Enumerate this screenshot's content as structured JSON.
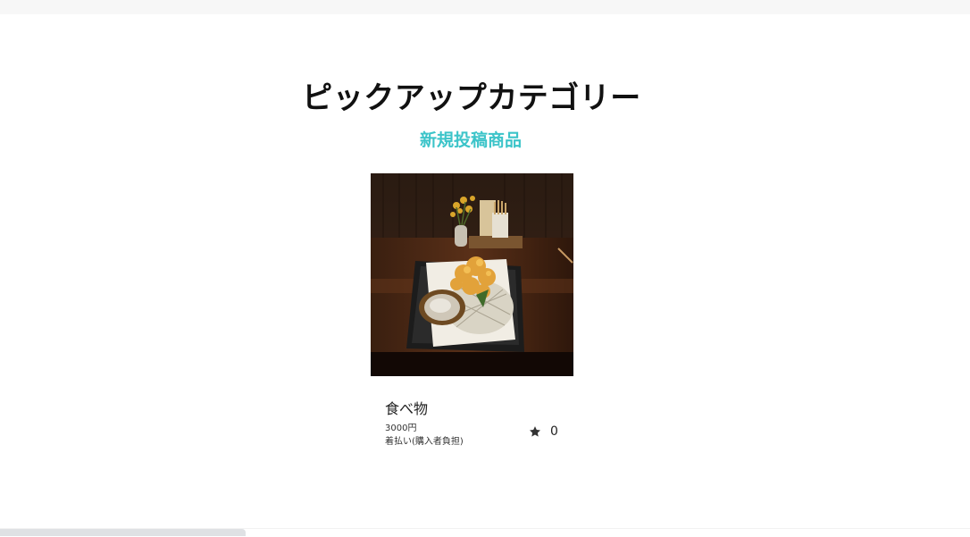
{
  "section": {
    "heading": "ピックアップカテゴリー",
    "subheading": "新規投稿商品"
  },
  "items": [
    {
      "title": "食べ物",
      "price": "3000円",
      "shipping": "着払い(購入者負担)",
      "likes": "0",
      "image": "tempura-dish-photo"
    }
  ],
  "colors": {
    "accent": "#3cc4c9",
    "heading": "#111111"
  }
}
